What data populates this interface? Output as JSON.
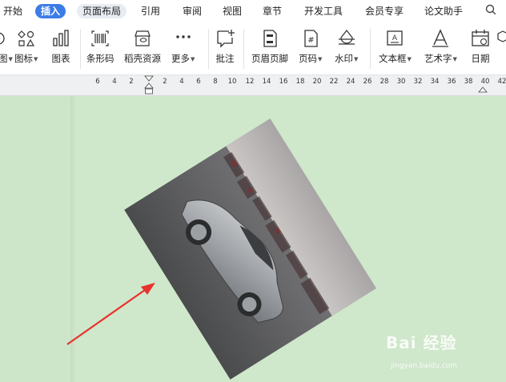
{
  "menubar": {
    "items": [
      {
        "label": "开始"
      },
      {
        "label": "插入"
      },
      {
        "label": "页面布局"
      },
      {
        "label": "引用"
      },
      {
        "label": "审阅"
      },
      {
        "label": "视图"
      },
      {
        "label": "章节"
      },
      {
        "label": "开发工具"
      },
      {
        "label": "会员专享"
      },
      {
        "label": "论文助手"
      }
    ],
    "active_tab": "插入"
  },
  "ribbon": {
    "tools": [
      {
        "label": "图",
        "icon": "shapes-icon",
        "has_dropdown": true
      },
      {
        "label": "图标",
        "icon": "icons-icon",
        "has_dropdown": true
      },
      {
        "label": "图表",
        "icon": "chart-icon",
        "has_dropdown": false
      },
      {
        "label": "条形码",
        "icon": "barcode-icon",
        "has_dropdown": false
      },
      {
        "label": "稻壳资源",
        "icon": "shop-icon",
        "has_dropdown": false
      },
      {
        "label": "更多",
        "icon": "more-icon",
        "has_dropdown": true
      },
      {
        "label": "批注",
        "icon": "comment-icon",
        "has_dropdown": false
      },
      {
        "label": "页眉页脚",
        "icon": "header-footer-icon",
        "has_dropdown": false
      },
      {
        "label": "页码",
        "icon": "page-number-icon",
        "has_dropdown": true
      },
      {
        "label": "水印",
        "icon": "watermark-icon",
        "has_dropdown": true
      },
      {
        "label": "文本框",
        "icon": "textbox-icon",
        "has_dropdown": true
      },
      {
        "label": "艺术字",
        "icon": "wordart-icon",
        "has_dropdown": true
      },
      {
        "label": "日期",
        "icon": "calendar-icon",
        "has_dropdown": false
      }
    ]
  },
  "ruler": {
    "ticks": [
      "6",
      "4",
      "2",
      "2",
      "4",
      "6",
      "8",
      "10",
      "12",
      "14",
      "16",
      "18",
      "20",
      "22",
      "24",
      "26",
      "28",
      "30",
      "32",
      "34",
      "36",
      "38",
      "40",
      "42"
    ]
  },
  "watermark": {
    "text": "Bai 经验",
    "sub": "jingyan.baidu.com"
  },
  "colors": {
    "accent": "#3b7ce6",
    "canvas": "#cde6c9",
    "arrow": "#e8322c"
  }
}
